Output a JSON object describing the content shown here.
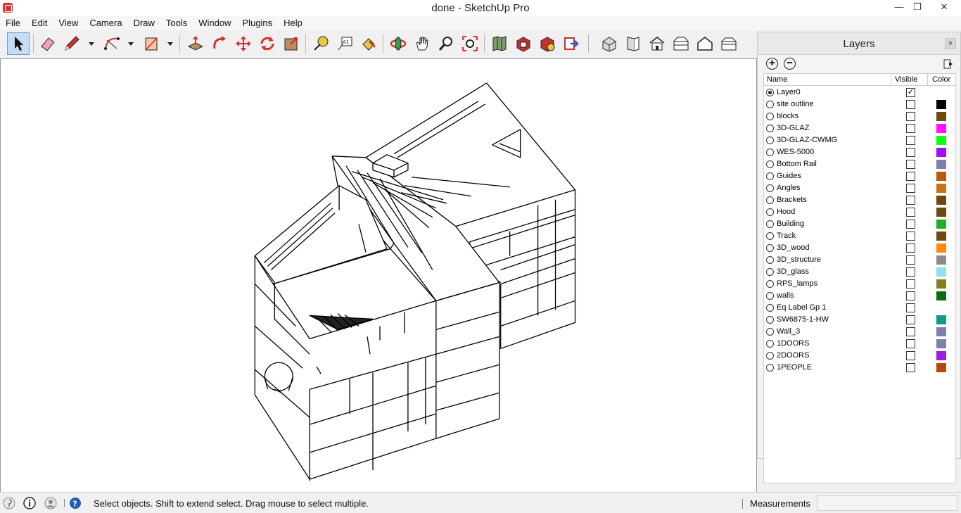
{
  "window": {
    "title": "done - SketchUp Pro",
    "minimize": "—",
    "restore": "❐",
    "close": "✕"
  },
  "menu": [
    "File",
    "Edit",
    "View",
    "Camera",
    "Draw",
    "Tools",
    "Window",
    "Plugins",
    "Help"
  ],
  "toolbar": {
    "tools": [
      "select-icon",
      "eraser-icon",
      "pencil-icon",
      "arc-icon",
      "rectangle-icon",
      "push-pull-icon",
      "follow-me-icon",
      "move-icon",
      "rotate-icon",
      "scale-icon",
      "tape-measure-icon",
      "text-icon",
      "paint-bucket-icon",
      "orbit-icon",
      "pan-icon",
      "zoom-icon",
      "zoom-extents-icon",
      "add-location-icon",
      "3d-warehouse-icon",
      "extension-warehouse-icon",
      "share-model-icon",
      "iso-view-icon",
      "front-view-icon",
      "top-view-icon",
      "right-view-icon",
      "back-view-icon",
      "left-view-icon"
    ]
  },
  "layers_panel": {
    "title": "Layers",
    "close": "×",
    "add": "+",
    "remove": "−",
    "headers": {
      "name": "Name",
      "visible": "Visible",
      "color": "Color"
    },
    "layers": [
      {
        "name": "Layer0",
        "active": true,
        "visible": true,
        "color": ""
      },
      {
        "name": "site outline",
        "active": false,
        "visible": false,
        "color": "#000000"
      },
      {
        "name": "blocks",
        "active": false,
        "visible": false,
        "color": "#6b4a12"
      },
      {
        "name": "3D-GLAZ",
        "active": false,
        "visible": false,
        "color": "#ff10ff"
      },
      {
        "name": "3D-GLAZ-CWMG",
        "active": false,
        "visible": false,
        "color": "#10ff10"
      },
      {
        "name": "WES-5000",
        "active": false,
        "visible": false,
        "color": "#a010f0"
      },
      {
        "name": "Bottom Rail",
        "active": false,
        "visible": false,
        "color": "#8080a8"
      },
      {
        "name": "Guides",
        "active": false,
        "visible": false,
        "color": "#b85a12"
      },
      {
        "name": "Angles",
        "active": false,
        "visible": false,
        "color": "#c8731a"
      },
      {
        "name": "Brackets",
        "active": false,
        "visible": false,
        "color": "#6a4a10"
      },
      {
        "name": "Hood",
        "active": false,
        "visible": false,
        "color": "#6a4a10"
      },
      {
        "name": "Building",
        "active": false,
        "visible": false,
        "color": "#22b022"
      },
      {
        "name": "Track",
        "active": false,
        "visible": false,
        "color": "#6a4a10"
      },
      {
        "name": "3D_wood",
        "active": false,
        "visible": false,
        "color": "#ff8a10"
      },
      {
        "name": "3D_structure",
        "active": false,
        "visible": false,
        "color": "#8a8a8a"
      },
      {
        "name": "3D_glass",
        "active": false,
        "visible": false,
        "color": "#90e0f8"
      },
      {
        "name": "RPS_lamps",
        "active": false,
        "visible": false,
        "color": "#808020"
      },
      {
        "name": "walls",
        "active": false,
        "visible": false,
        "color": "#106810"
      },
      {
        "name": "Eq Label Gp 1",
        "active": false,
        "visible": false,
        "color": ""
      },
      {
        "name": "SW6875-1-HW",
        "active": false,
        "visible": false,
        "color": "#109a8a"
      },
      {
        "name": "Wall_3",
        "active": false,
        "visible": false,
        "color": "#8080a8"
      },
      {
        "name": "1DOORS",
        "active": false,
        "visible": false,
        "color": "#8080a8"
      },
      {
        "name": "2DOORS",
        "active": false,
        "visible": false,
        "color": "#9a20e0"
      },
      {
        "name": "1PEOPLE",
        "active": false,
        "visible": false,
        "color": "#b84a08"
      }
    ]
  },
  "status": {
    "message": "Select objects. Shift to extend select. Drag mouse to select multiple.",
    "measurements_label": "Measurements",
    "measurements_value": ""
  }
}
